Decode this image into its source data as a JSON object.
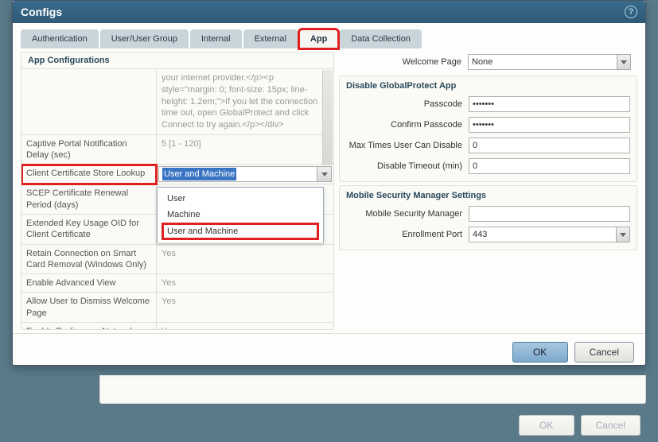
{
  "header": {
    "title": "Configs"
  },
  "tabs": {
    "authentication": "Authentication",
    "user_group": "User/User Group",
    "internal": "Internal",
    "external": "External",
    "app": "App",
    "data_collection": "Data Collection"
  },
  "app_config": {
    "title": "App Configurations",
    "raw_message": "your internet provider.</p><p style=\"margin: 0; font-size: 15px; line-height: 1.2em;\">If you let the connection time out, open GlobalProtect and click Connect to try again.</p></div>",
    "rows": {
      "captive_portal_delay": {
        "label": "Captive Portal Notification Delay (sec)",
        "value": "5 [1 - 120]"
      },
      "client_cert_lookup": {
        "label": "Client Certificate Store Lookup",
        "value": "User and Machine"
      },
      "scep_renewal": {
        "label": "SCEP Certificate Renewal Period (days)",
        "value": ""
      },
      "eku_oid": {
        "label": "Extended Key Usage OID for Client Certificate",
        "value": ""
      },
      "retain_smartcard": {
        "label": "Retain Connection on Smart Card Removal (Windows Only)",
        "value": "Yes"
      },
      "enable_advanced": {
        "label": "Enable Advanced View",
        "value": "Yes"
      },
      "dismiss_welcome": {
        "label": "Allow User to Dismiss Welcome Page",
        "value": "Yes"
      },
      "rediscover_network": {
        "label": "Enable Rediscover Network Option",
        "value": "Yes"
      }
    },
    "dropdown_options": {
      "user": "User",
      "machine": "Machine",
      "user_and_machine": "User and Machine"
    }
  },
  "right": {
    "welcome_page": {
      "label": "Welcome Page",
      "value": "None"
    },
    "disable_gp": {
      "title": "Disable GlobalProtect App",
      "passcode": {
        "label": "Passcode",
        "value": "•••••••"
      },
      "confirm": {
        "label": "Confirm Passcode",
        "value": "•••••••"
      },
      "max_times": {
        "label": "Max Times User Can Disable",
        "value": "0"
      },
      "timeout": {
        "label": "Disable Timeout (min)",
        "value": "0"
      }
    },
    "msm": {
      "title": "Mobile Security Manager Settings",
      "manager": {
        "label": "Mobile Security Manager",
        "value": ""
      },
      "port": {
        "label": "Enrollment Port",
        "value": "443"
      }
    }
  },
  "buttons": {
    "ok": "OK",
    "cancel": "Cancel"
  }
}
